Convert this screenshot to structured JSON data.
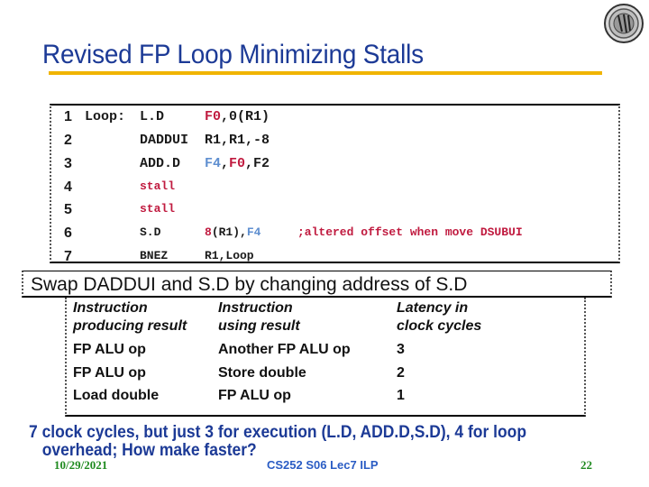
{
  "slide": {
    "title": "Revised FP Loop Minimizing Stalls",
    "logo_icon": "university-seal-icon",
    "code": [
      {
        "num": "1",
        "label": "Loop:",
        "op": "L.D",
        "args": [
          {
            "t": "F0",
            "c": "red"
          },
          {
            "t": ",0(R1)",
            "c": ""
          }
        ],
        "comment": ""
      },
      {
        "num": "2",
        "label": "",
        "op": "DADDUI",
        "args": [
          {
            "t": "R1,R1,-8",
            "c": ""
          }
        ],
        "comment": ""
      },
      {
        "num": "3",
        "label": "",
        "op": "ADD.D",
        "args": [
          {
            "t": "F4",
            "c": "blue"
          },
          {
            "t": ",",
            "c": ""
          },
          {
            "t": "F0",
            "c": "red"
          },
          {
            "t": ",F2",
            "c": ""
          }
        ],
        "comment": ""
      },
      {
        "num": "4",
        "label": "",
        "op": "stall",
        "args": [],
        "comment": ""
      },
      {
        "num": "5",
        "label": "",
        "op": "stall",
        "args": [],
        "comment": ""
      },
      {
        "num": "6",
        "label": "",
        "op": "S.D",
        "args": [
          {
            "t": "8",
            "c": "red"
          },
          {
            "t": "(R1),",
            "c": ""
          },
          {
            "t": "F4",
            "c": "blue"
          }
        ],
        "comment": ";altered offset when move DSUBUI"
      },
      {
        "num": "7",
        "label": "",
        "op": "BNEZ",
        "args": [
          {
            "t": "R1,Loop",
            "c": ""
          }
        ],
        "comment": ""
      }
    ],
    "swap_note": "Swap DADDUI and S.D by changing address of S.D",
    "table": {
      "headers": [
        [
          "Instruction",
          "producing result"
        ],
        [
          "Instruction",
          "using result"
        ],
        [
          "Latency in",
          "clock cycles"
        ]
      ],
      "rows": [
        [
          "FP ALU op",
          "Another FP ALU op",
          "3"
        ],
        [
          "FP ALU op",
          "Store double",
          "2"
        ],
        [
          "Load double",
          "FP ALU op",
          "1"
        ]
      ]
    },
    "summary": {
      "line1": "7 clock cycles, but just 3 for execution (L.D, ADD.D,S.D), 4 for loop",
      "line2": "overhead; How make  faster?"
    },
    "footer": {
      "date": "10/29/2021",
      "course": "CS252 S06 Lec7 ILP",
      "page": "22"
    },
    "colors": {
      "title": "#1c3a96",
      "rule": "#f0b400",
      "register_red": "#c01a3f",
      "register_blue": "#5f8fd0",
      "footer_green": "#1f8a1f",
      "footer_blue": "#2a5cc4"
    }
  }
}
